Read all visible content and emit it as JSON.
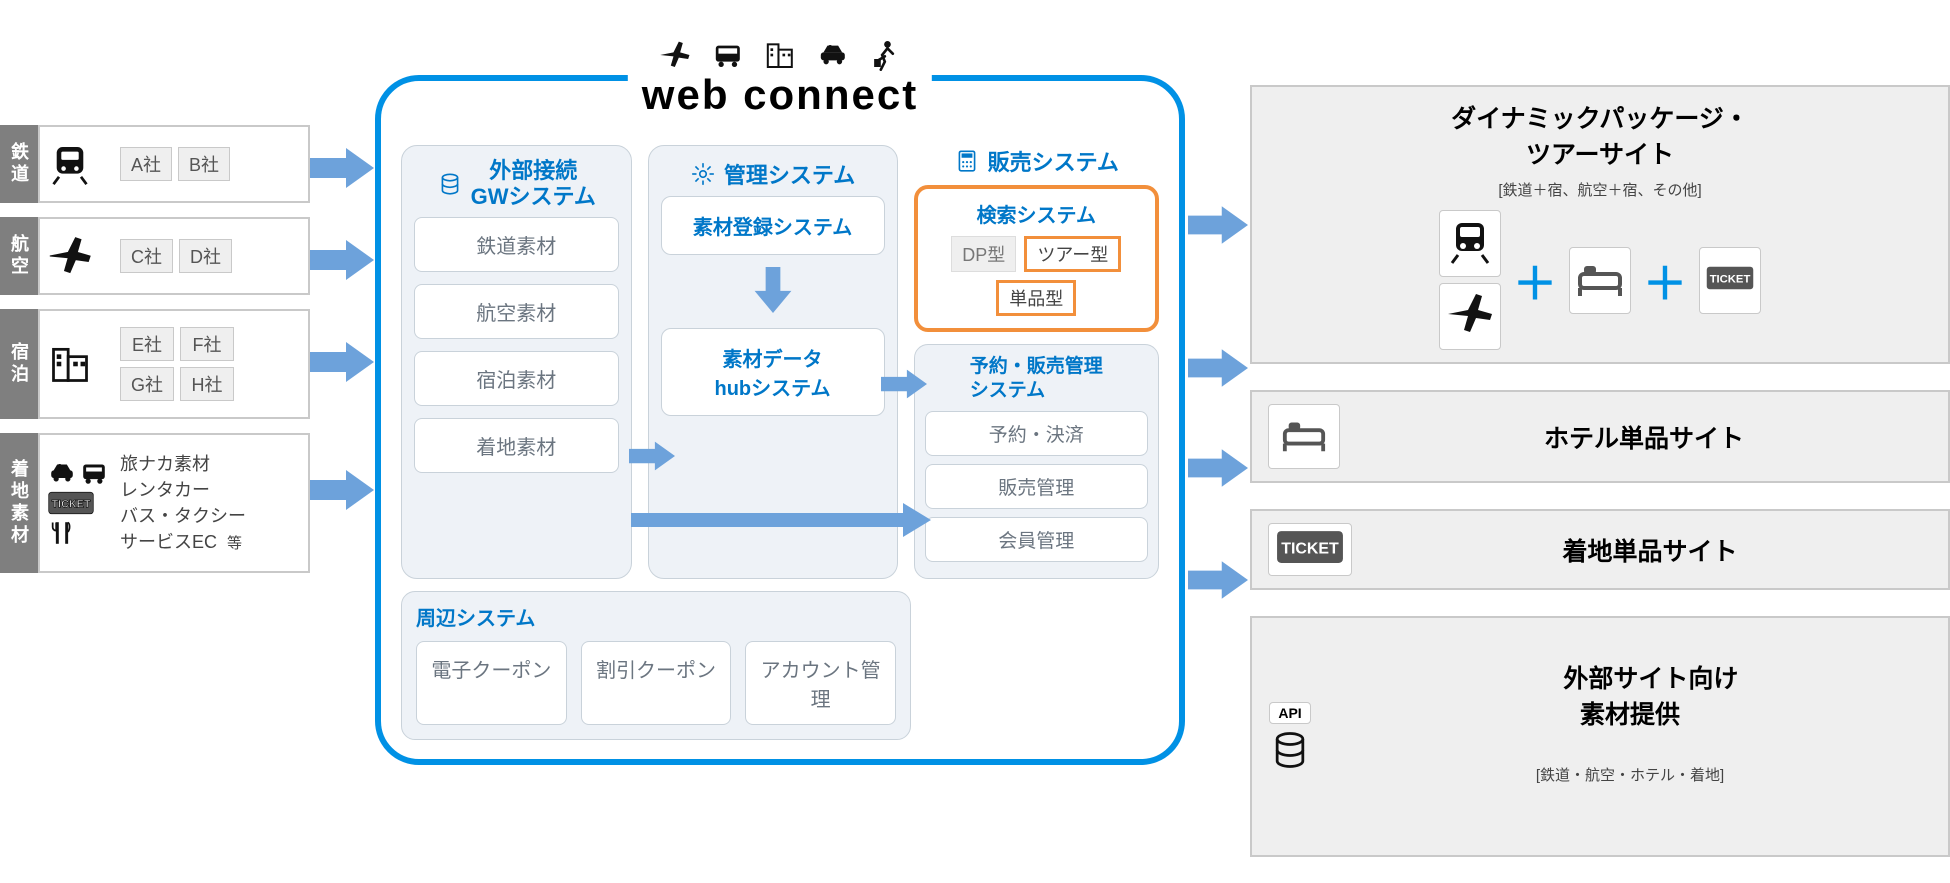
{
  "brand": "web connect",
  "left": {
    "rail": {
      "label": "鉄道",
      "companies": [
        "A社",
        "B社"
      ]
    },
    "air": {
      "label": "航空",
      "companies": [
        "C社",
        "D社"
      ]
    },
    "stay": {
      "label": "宿泊",
      "companies": [
        "E社",
        "F社",
        "G社",
        "H社"
      ]
    },
    "land": {
      "label": "着地素材",
      "lines": [
        "旅ナカ素材",
        "レンタカー",
        "バス・タクシー",
        "サービスEC"
      ],
      "etc": "等"
    }
  },
  "center": {
    "gw": {
      "title1": "外部接続",
      "title2": "GWシステム",
      "items": [
        "鉄道素材",
        "航空素材",
        "宿泊素材",
        "着地素材"
      ]
    },
    "mgmt": {
      "title": "管理システム",
      "register": "素材登録システム",
      "hub": "素材データ\nhubシステム"
    },
    "sales": {
      "title": "販売システム",
      "search": {
        "title": "検索システム",
        "plain": "DP型",
        "hi": [
          "ツアー型",
          "単品型"
        ]
      },
      "reserve": {
        "title": "予約・販売管理\nシステム",
        "items": [
          "予約・決済",
          "販売管理",
          "会員管理"
        ]
      }
    },
    "periph": {
      "title": "周辺システム",
      "items": [
        "電子クーポン",
        "割引クーポン",
        "アカウント管理"
      ]
    }
  },
  "right": {
    "dp": {
      "title": "ダイナミックパッケージ・\nツアーサイト",
      "sub": "[鉄道＋宿、航空＋宿、その他]"
    },
    "hotel": {
      "title": "ホテル単品サイト"
    },
    "land": {
      "title": "着地単品サイト"
    },
    "api": {
      "label": "API",
      "title": "外部サイト向け\n素材提供",
      "sub": "[鉄道・航空・ホテル・着地]"
    }
  }
}
